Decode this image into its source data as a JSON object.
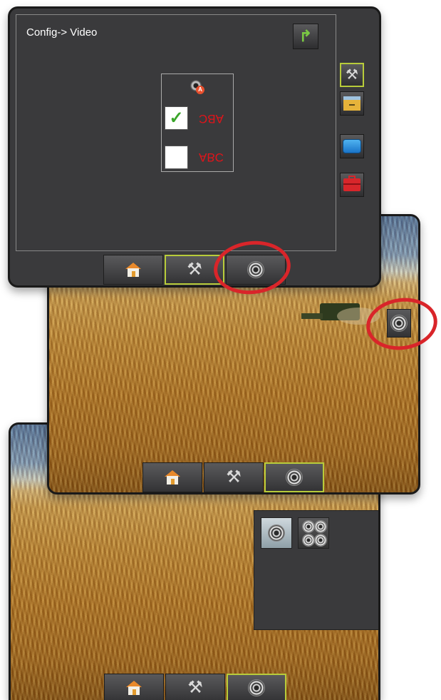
{
  "config_screen": {
    "title": "Config-> Video",
    "options": [
      {
        "label": "ABC",
        "checked": true,
        "mirrored": true
      },
      {
        "label": "ABC",
        "checked": false,
        "mirrored": false
      }
    ],
    "sidebar_icons": [
      "tools-icon",
      "archive-icon",
      "display-icon",
      "toolbox-icon"
    ],
    "check_glyph": "✓"
  },
  "bottom_tabs": [
    "home-icon",
    "tools-icon",
    "camera-icon"
  ],
  "accent_color": "#b8cc3a",
  "highlight_color": "#d9252a",
  "label_color": "#e0141a"
}
